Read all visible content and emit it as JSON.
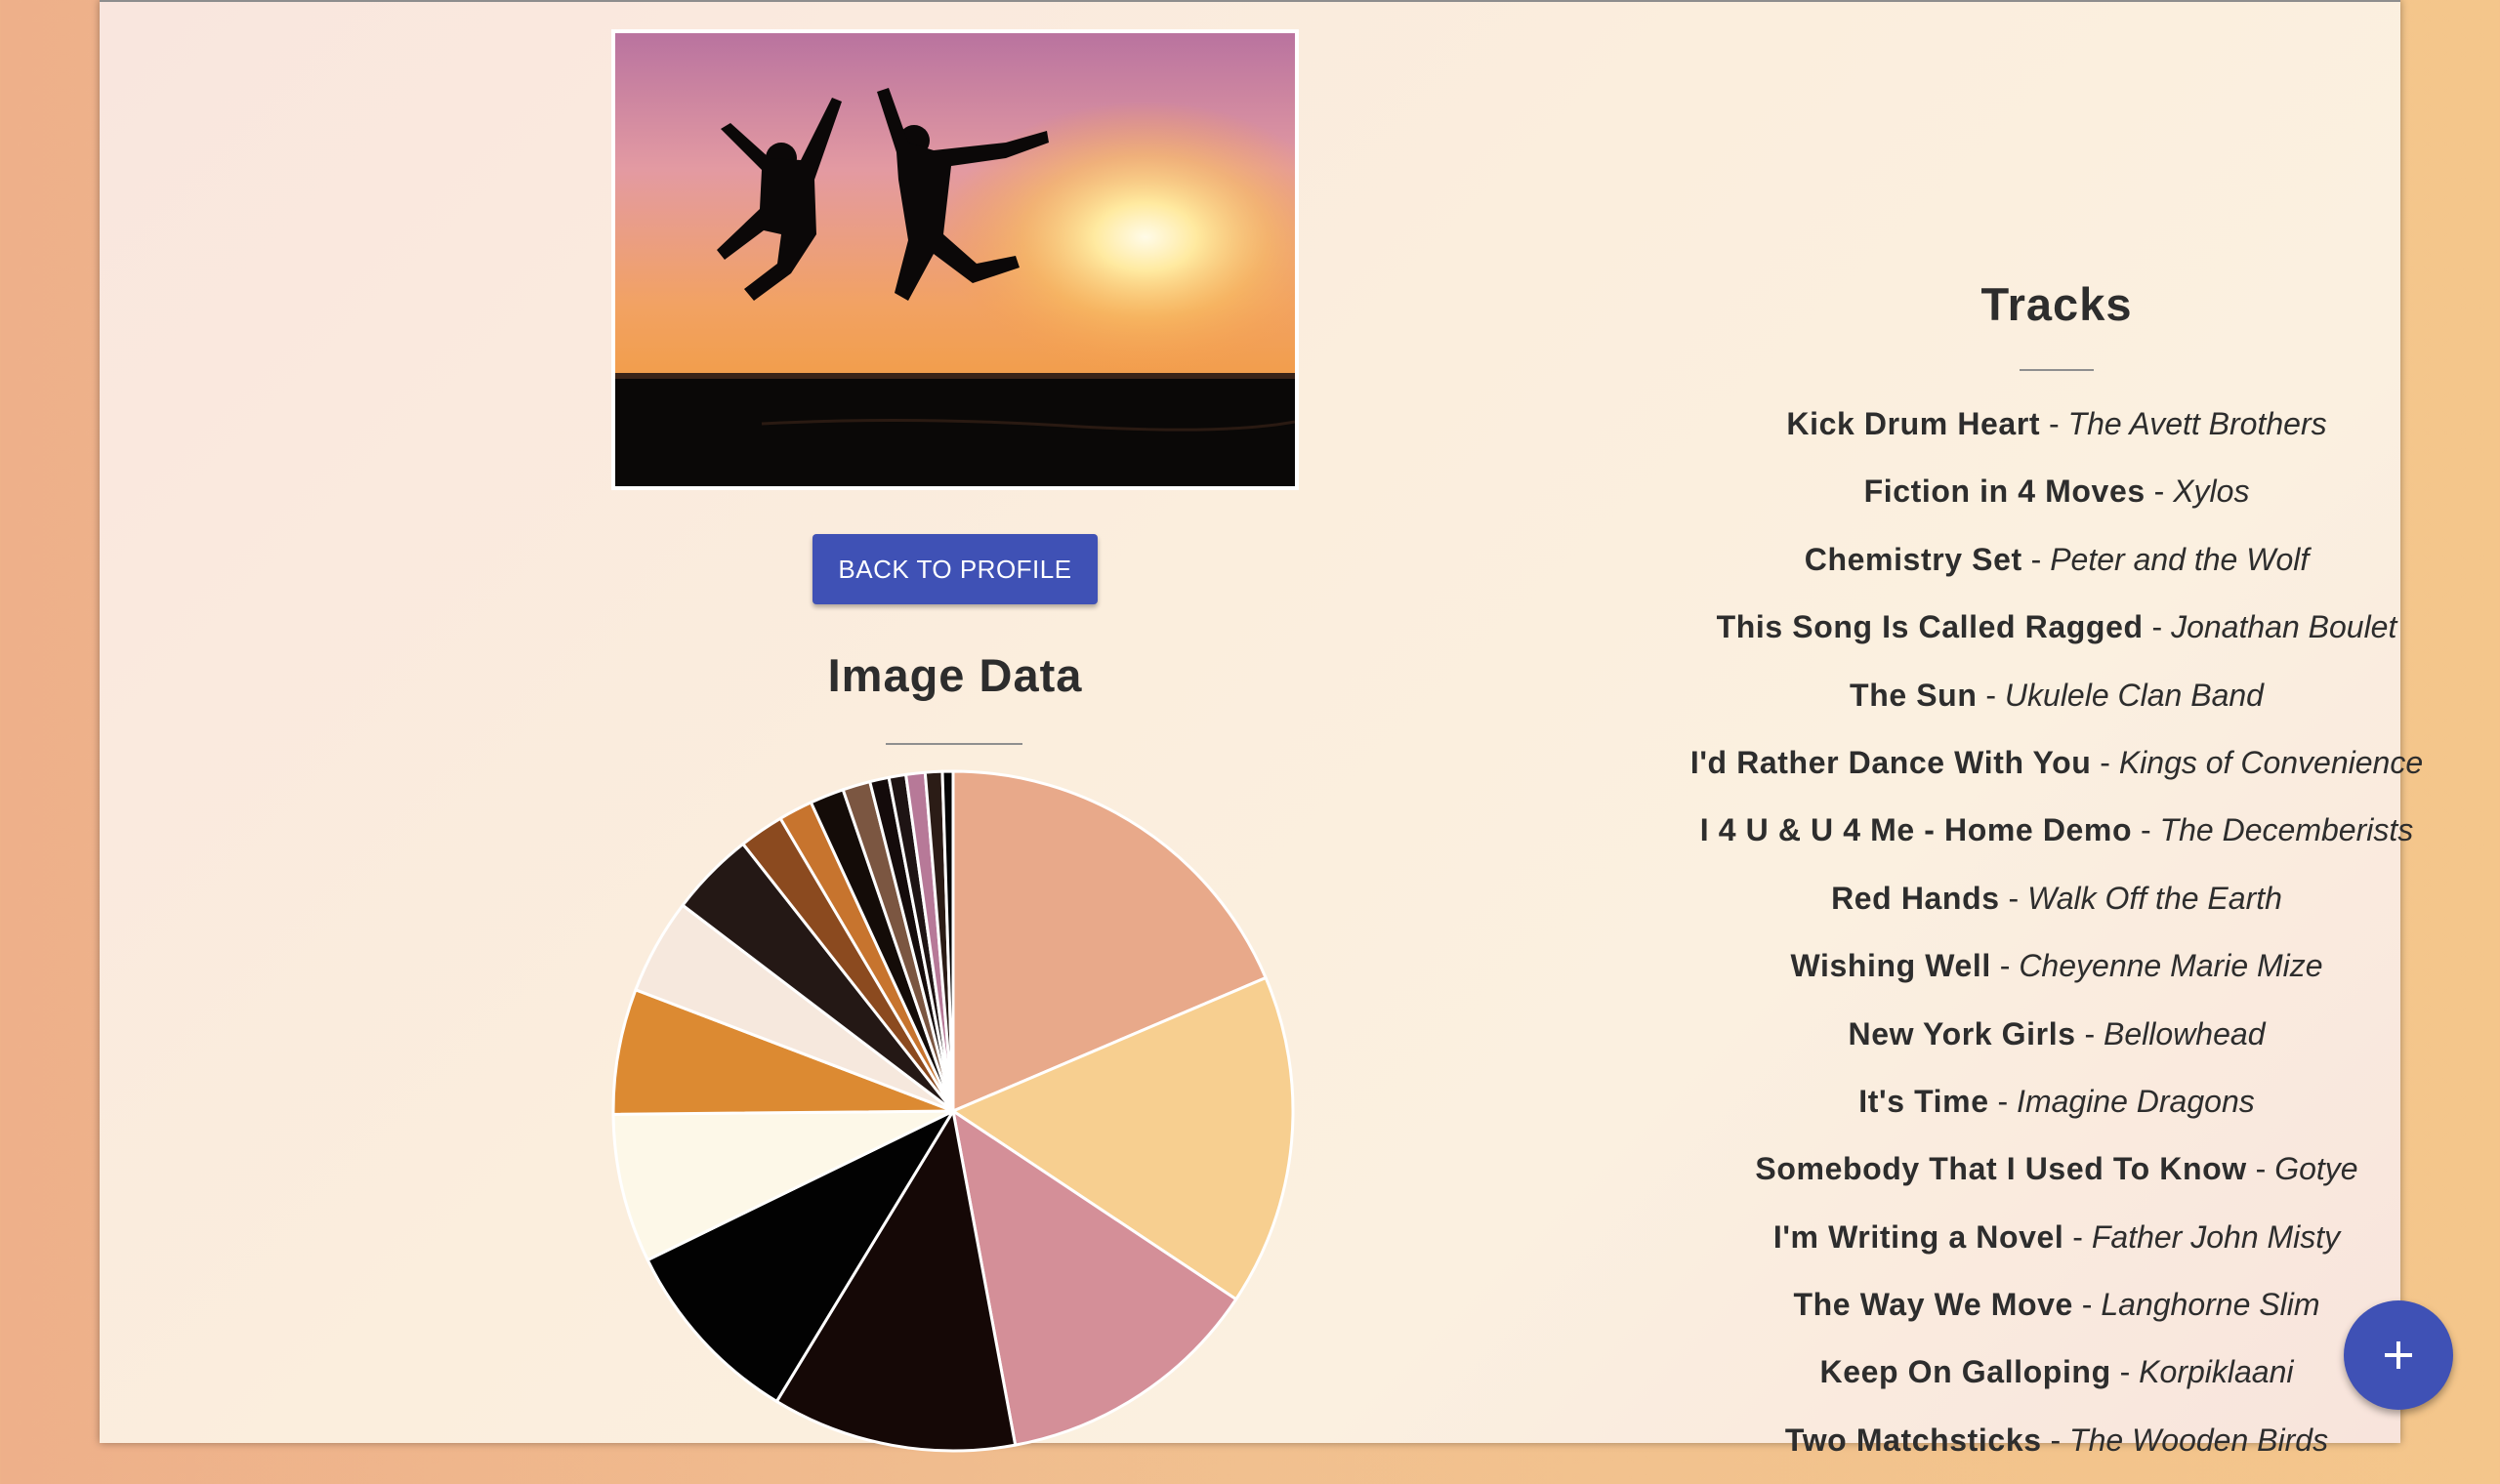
{
  "back_button": {
    "label": "BACK TO PROFILE"
  },
  "image_section": {
    "title": "Image Data"
  },
  "tracks_section": {
    "title": "Tracks",
    "separator": " - ",
    "items": [
      {
        "song": "Kick Drum Heart",
        "artist": "The Avett Brothers"
      },
      {
        "song": "Fiction in 4 Moves",
        "artist": "Xylos"
      },
      {
        "song": "Chemistry Set",
        "artist": "Peter and the Wolf"
      },
      {
        "song": "This Song Is Called Ragged",
        "artist": "Jonathan Boulet"
      },
      {
        "song": "The Sun",
        "artist": "Ukulele Clan Band"
      },
      {
        "song": "I'd Rather Dance With You",
        "artist": "Kings of Convenience"
      },
      {
        "song": "I 4 U & U 4 Me - Home Demo",
        "artist": "The Decemberists"
      },
      {
        "song": "Red Hands",
        "artist": "Walk Off the Earth"
      },
      {
        "song": "Wishing Well",
        "artist": "Cheyenne Marie Mize"
      },
      {
        "song": "New York Girls",
        "artist": "Bellowhead"
      },
      {
        "song": "It's Time",
        "artist": "Imagine Dragons"
      },
      {
        "song": "Somebody That I Used To Know",
        "artist": "Gotye"
      },
      {
        "song": "I'm Writing a Novel",
        "artist": "Father John Misty"
      },
      {
        "song": "The Way We Move",
        "artist": "Langhorne Slim"
      },
      {
        "song": "Keep On Galloping",
        "artist": "Korpiklaani"
      },
      {
        "song": "Two Matchsticks",
        "artist": "The Wooden Birds"
      }
    ]
  },
  "fab": {
    "icon": "plus-icon"
  },
  "colors": {
    "accent": "#3f51b5"
  },
  "chart_data": {
    "type": "pie",
    "slices": [
      {
        "value": 18.4,
        "color": "#e8a98a"
      },
      {
        "value": 15.6,
        "color": "#f7cf90"
      },
      {
        "value": 12.6,
        "color": "#d48f98"
      },
      {
        "value": 11.5,
        "color": "#150806"
      },
      {
        "value": 9.0,
        "color": "#020202"
      },
      {
        "value": 7.0,
        "color": "#fdf8e8"
      },
      {
        "value": 5.9,
        "color": "#dc8a32"
      },
      {
        "value": 4.5,
        "color": "#f6e8dd"
      },
      {
        "value": 4.0,
        "color": "#241815"
      },
      {
        "value": 2.1,
        "color": "#8b4a1f"
      },
      {
        "value": 1.6,
        "color": "#c7742e"
      },
      {
        "value": 1.6,
        "color": "#140c08"
      },
      {
        "value": 1.3,
        "color": "#7b5641"
      },
      {
        "value": 0.9,
        "color": "#140b0b"
      },
      {
        "value": 0.8,
        "color": "#1e1414"
      },
      {
        "value": 0.9,
        "color": "#b77998"
      },
      {
        "value": 0.8,
        "color": "#2b1c16"
      },
      {
        "value": 0.5,
        "color": "#050505"
      }
    ]
  }
}
